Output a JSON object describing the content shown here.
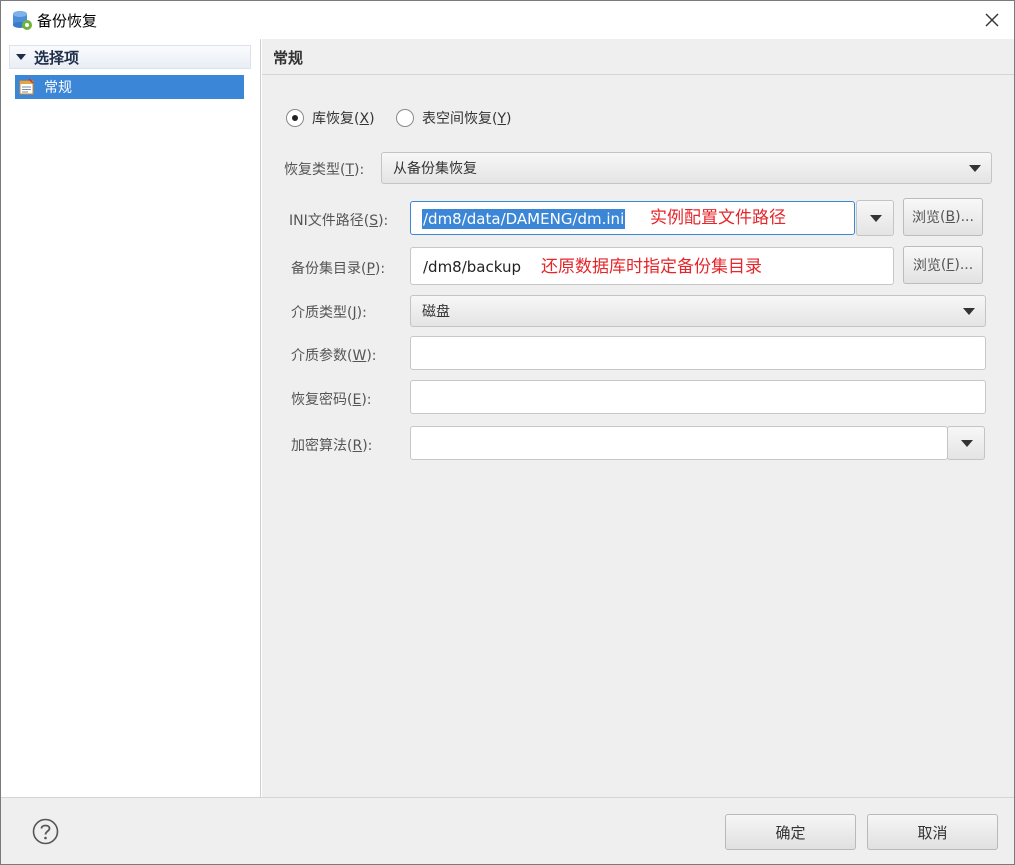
{
  "window": {
    "title": "备份恢复",
    "icon": "database-gear-icon",
    "close_icon": "close-icon"
  },
  "sidebar": {
    "header": "选择项",
    "items": [
      {
        "label": "常规",
        "icon": "settings-page-icon",
        "selected": true
      }
    ]
  },
  "content": {
    "title": "常规",
    "restore_scope": {
      "options": [
        {
          "label": "库恢复",
          "mnemonic": "X",
          "checked": true
        },
        {
          "label": "表空间恢复",
          "mnemonic": "Y",
          "checked": false
        }
      ]
    },
    "fields": {
      "restore_type": {
        "label": "恢复类型",
        "mnemonic": "T",
        "value": "从备份集恢复"
      },
      "ini_path": {
        "label": "INI文件路径",
        "mnemonic": "S",
        "value": "/dm8/data/DAMENG/dm.ini",
        "annotation": "实例配置文件路径"
      },
      "backup_dir": {
        "label": "备份集目录",
        "mnemonic": "P",
        "value": "/dm8/backup",
        "annotation": "还原数据库时指定备份集目录"
      },
      "media_type": {
        "label": "介质类型",
        "mnemonic": "J",
        "value": "磁盘"
      },
      "media_params": {
        "label": "介质参数",
        "mnemonic": "W",
        "value": ""
      },
      "restore_password": {
        "label": "恢复密码",
        "mnemonic": "E",
        "value": ""
      },
      "encrypt_algorithm": {
        "label": "加密算法",
        "mnemonic": "R",
        "value": ""
      }
    },
    "browse_ini": {
      "label": "浏览",
      "mnemonic": "B"
    },
    "browse_backup": {
      "label": "浏览",
      "mnemonic": "F"
    }
  },
  "footer": {
    "help_icon": "help-icon",
    "ok_label": "确定",
    "cancel_label": "取消"
  },
  "colors": {
    "selection": "#3b86d6",
    "annotation": "#e5262a",
    "panel_background": "#efefef"
  }
}
